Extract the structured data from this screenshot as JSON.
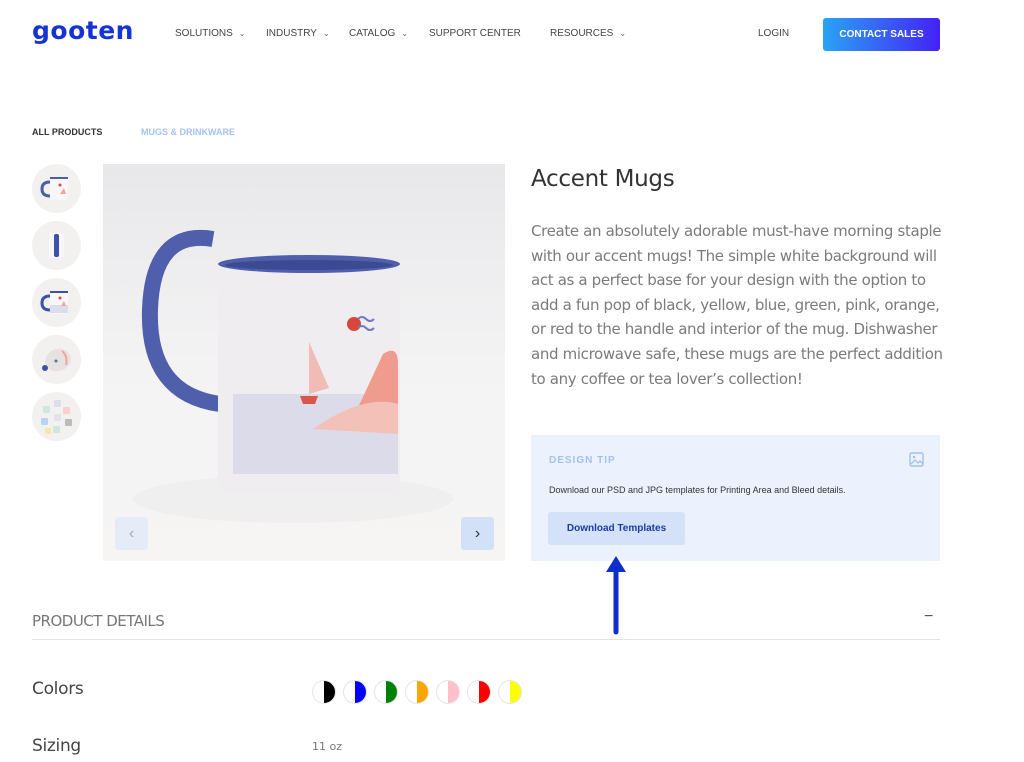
{
  "header": {
    "logo": "gooten",
    "nav": [
      {
        "label": "SOLUTIONS",
        "dropdown": true
      },
      {
        "label": "INDUSTRY",
        "dropdown": true
      },
      {
        "label": "CATALOG",
        "dropdown": true
      },
      {
        "label": "SUPPORT CENTER",
        "dropdown": false
      },
      {
        "label": "RESOURCES",
        "dropdown": true
      }
    ],
    "login": "LOGIN",
    "contact_sales": "CONTACT SALES",
    "chevron": "⌄"
  },
  "breadcrumb": {
    "items": [
      "ALL PRODUCTS",
      "MUGS & DRINKWARE"
    ],
    "colors": [
      "#333333",
      "#a6c3f0"
    ]
  },
  "gallery": {
    "thumbnail_count": 5,
    "prev_icon": "‹",
    "next_icon": "›"
  },
  "product": {
    "title": "Accent Mugs",
    "description": "Create an absolutely adorable must-have morning staple with our accent mugs! The simple white background will act as a perfect base for your design with the option to add a fun pop of black, yellow, blue, green, pink, orange, or red to the handle and interior of the mug. Dishwasher and microwave safe, these mugs are the perfect addition to any coffee or tea lover’s collection!"
  },
  "design_tip": {
    "title": "DESIGN TIP",
    "text": "Download our PSD and JPG templates for Printing Area and Bleed details.",
    "button": "Download Templates",
    "icon": "image-icon"
  },
  "details": {
    "title": "PRODUCT DETAILS",
    "toggle": "−",
    "colors_label": "Colors",
    "colors": [
      {
        "name": "black",
        "hex": "#000000"
      },
      {
        "name": "blue",
        "hex": "#0000ff"
      },
      {
        "name": "green",
        "hex": "#008000"
      },
      {
        "name": "orange",
        "hex": "#ffa500"
      },
      {
        "name": "pink",
        "hex": "#ffc0cb"
      },
      {
        "name": "red",
        "hex": "#ff0000"
      },
      {
        "name": "yellow",
        "hex": "#ffff00"
      }
    ],
    "sizing_label": "Sizing",
    "sizing_value": "11 oz"
  },
  "accent": {
    "brand": "#1533d6",
    "annotation_arrow": "#0d2fc9"
  }
}
